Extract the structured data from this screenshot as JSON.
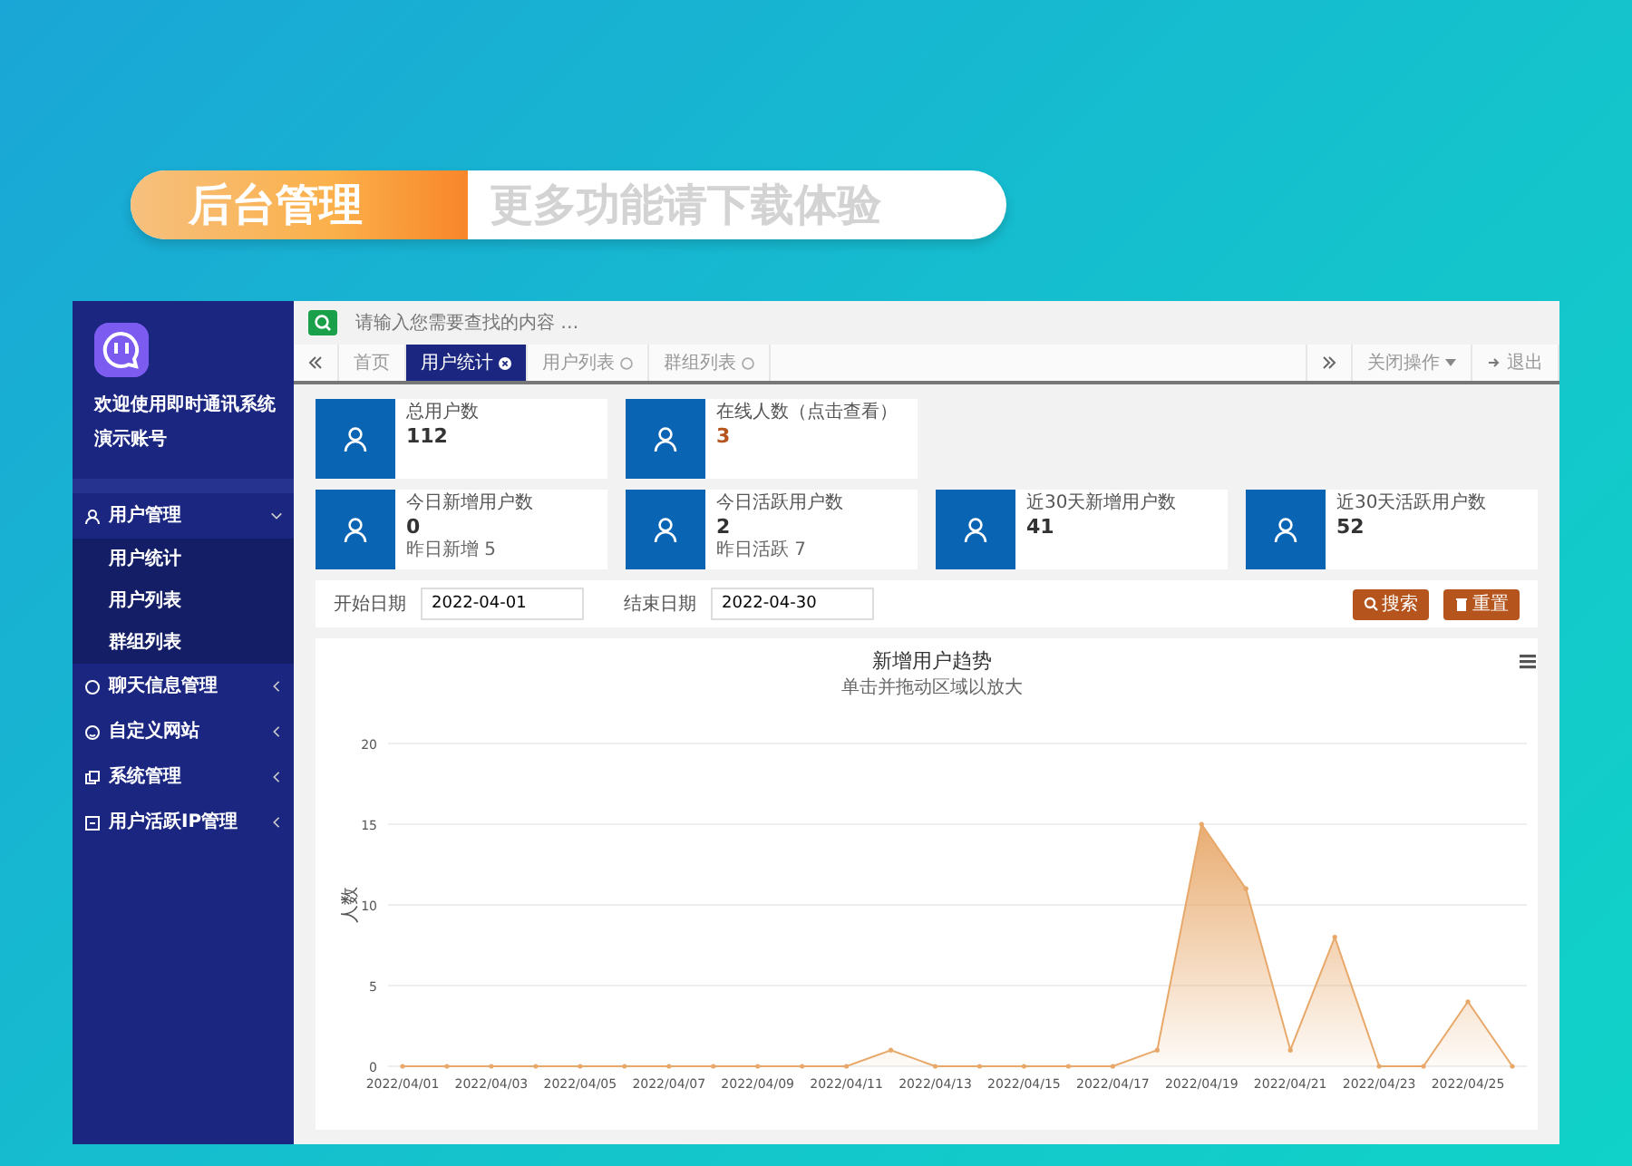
{
  "banner": {
    "highlight": "后台管理",
    "text": "更多功能请下载体验"
  },
  "sidebar": {
    "welcome": "欢迎使用即时通讯系统",
    "account": "演示账号",
    "menu": [
      {
        "label": "用户管理",
        "expanded": true,
        "children": [
          {
            "label": "用户统计"
          },
          {
            "label": "用户列表"
          },
          {
            "label": "群组列表"
          }
        ]
      },
      {
        "label": "聊天信息管理",
        "expanded": false
      },
      {
        "label": "自定义网站",
        "expanded": false
      },
      {
        "label": "系统管理",
        "expanded": false
      },
      {
        "label": "用户活跃IP管理",
        "expanded": false
      }
    ]
  },
  "search": {
    "placeholder": "请输入您需要查找的内容 …"
  },
  "tabs": [
    {
      "label": "首页",
      "selected": false,
      "closable": false
    },
    {
      "label": "用户统计",
      "selected": true,
      "closable": true
    },
    {
      "label": "用户列表",
      "selected": false,
      "closable": true
    },
    {
      "label": "群组列表",
      "selected": false,
      "closable": true
    }
  ],
  "toolbar": {
    "close_ops": "关闭操作",
    "logout": "退出"
  },
  "stat_rows": [
    [
      {
        "label": "总用户数",
        "value": "112",
        "color": "#333333"
      },
      {
        "label": "在线人数（点击查看）",
        "value": "3",
        "color": "#b5541c"
      }
    ],
    [
      {
        "label": "今日新增用户数",
        "value": "0",
        "note": "昨日新增 5",
        "color": "#333333"
      },
      {
        "label": "今日活跃用户数",
        "value": "2",
        "note": "昨日活跃 7",
        "color": "#333333"
      },
      {
        "label": "近30天新增用户数",
        "value": "41",
        "color": "#333333"
      },
      {
        "label": "近30天活跃用户数",
        "value": "52",
        "color": "#333333"
      }
    ]
  ],
  "filter": {
    "start_label": "开始日期",
    "start_value": "2022-04-01",
    "end_label": "结束日期",
    "end_value": "2022-04-30",
    "buttons": [
      {
        "label": "搜索",
        "kind": "search"
      },
      {
        "label": "重置",
        "kind": "reset"
      }
    ]
  },
  "chart": {
    "chart_data": {
      "type": "area",
      "title": "新增用户趋势",
      "subtitle": "单击并拖动区域以放大",
      "ylabel": "人数",
      "categories": [
        "2022/04/01",
        null,
        "2022/04/03",
        null,
        "2022/04/05",
        null,
        "2022/04/07",
        null,
        "2022/04/09",
        null,
        "2022/04/11",
        null,
        "2022/04/13",
        null,
        "2022/04/15",
        null,
        "2022/04/17",
        null,
        "2022/04/19",
        null,
        "2022/04/21",
        null,
        "2022/04/23",
        null,
        "2022/04/25",
        null
      ],
      "grid": true,
      "series": [
        {
          "color": "#e8a86a",
          "values": [
            0,
            0,
            0,
            0,
            0,
            0,
            0,
            0,
            0,
            0,
            0,
            1,
            0,
            0,
            0,
            0,
            0,
            1,
            15,
            11,
            1,
            8,
            0,
            0,
            4,
            0
          ]
        }
      ],
      "ylim": [
        0,
        20
      ],
      "yticks": [
        0,
        5,
        10,
        15,
        20
      ]
    }
  }
}
